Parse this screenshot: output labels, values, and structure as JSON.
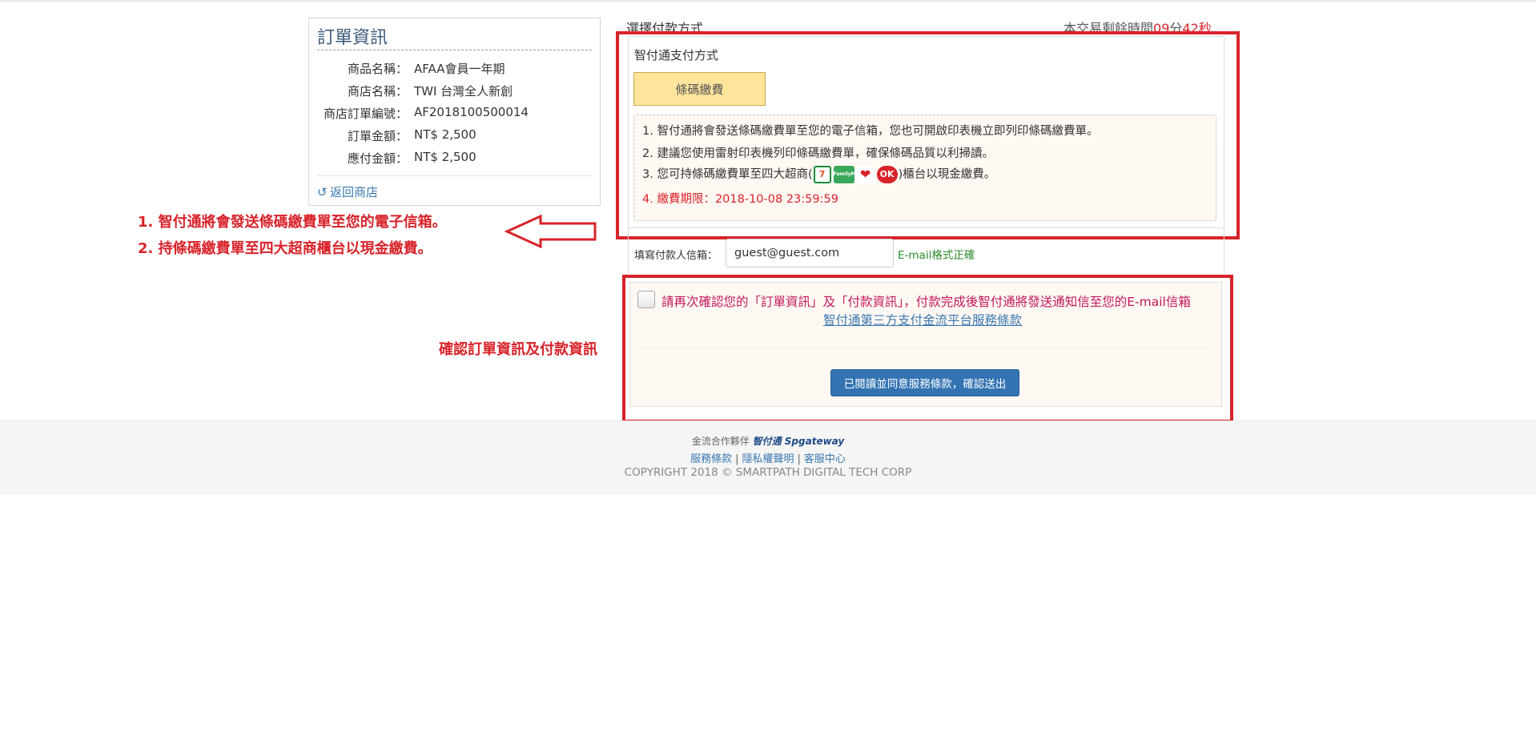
{
  "order": {
    "title": "訂單資訊",
    "rows": [
      {
        "label": "商品名稱：",
        "value": "AFAA會員一年期"
      },
      {
        "label": "商店名稱：",
        "value": "TWI 台灣全人新創"
      },
      {
        "label": "商店訂單編號：",
        "value": "AF2018100500014"
      },
      {
        "label": "訂單金額：",
        "value": "NT$ 2,500"
      },
      {
        "label": "應付金額：",
        "value": "NT$ 2,500"
      }
    ],
    "back_label": "返回商店"
  },
  "annotations": {
    "note1": "1. 智付通將會發送條碼繳費單至您的電子信箱。",
    "note2": "2. 持條碼繳費單至四大超商櫃台以現金繳費。",
    "note3": "確認訂單資訊及付款資訊"
  },
  "payment": {
    "heading": "選擇付款方式",
    "countdown": {
      "prefix": "本交易剩餘時間",
      "minutes": "09",
      "min_unit": "分",
      "seconds": "42",
      "sec_unit": "秒"
    },
    "method_title": "智付通支付方式",
    "barcode_button": "條碼繳費",
    "info": {
      "line1": "1. 智付通將會發送條碼繳費單至您的電子信箱，您也可開啟印表機立即列印條碼繳費單。",
      "line2": "2. 建議您使用雷射印表機列印條碼繳費單，確保條碼品質以利掃讀。",
      "line3_pre": "3. 您可持條碼繳費單至四大超商(",
      "line3_post": ")櫃台以現金繳費。",
      "stores": {
        "s711": "7",
        "family": "FamilyMart",
        "hilife": "❤",
        "ok": "OK"
      },
      "deadline": "4. 繳費期限：2018-10-08 23:59:59"
    },
    "email_label": "填寫付款人信箱：",
    "email_value": "guest@guest.com",
    "email_status": "E-mail格式正確",
    "confirm_text": "請再次確認您的「訂單資訊」及「付款資訊」，付款完成後智付通將發送通知信至您的E-mail信箱",
    "terms_link": "智付通第三方支付金流平台服務條款",
    "submit_label": "已閱讀並同意服務條款，確認送出"
  },
  "footer": {
    "partner_label": "金流合作夥伴",
    "partner_logo": "智付通 Spgateway",
    "links": [
      "服務條款",
      "隱私權聲明",
      "客服中心"
    ],
    "copyright": "COPYRIGHT 2018 © SMARTPATH DIGITAL TECH CORP"
  },
  "colors": {
    "accent_red": "#d8232a",
    "button_blue": "#3373b2",
    "barcode_yellow": "#ffe59c"
  }
}
